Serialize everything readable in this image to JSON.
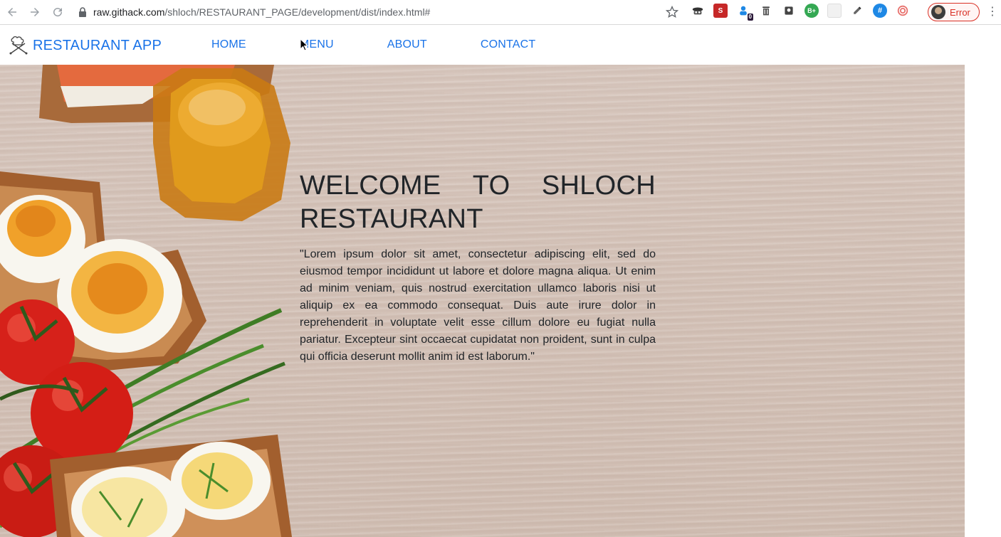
{
  "browser": {
    "url_host": "raw.githack.com",
    "url_path": "/shloch/RESTAURANT_PAGE/development/dist/index.html#",
    "profile_status": "Error",
    "extension_badge": "0",
    "extension_b_plus": "B+",
    "extension_hash": "#",
    "extension_s": "S"
  },
  "navbar": {
    "brand": "RESTAURANT APP",
    "links": [
      "HOME",
      "MENU",
      "ABOUT",
      "CONTACT"
    ]
  },
  "hero": {
    "title_words": [
      "WELCOME",
      "TO",
      "SHLOCH"
    ],
    "title_line2": "RESTAURANT",
    "paragraph": "\"Lorem ipsum dolor sit amet, consectetur adipiscing elit, sed do eiusmod tempor incididunt ut labore et dolore magna aliqua. Ut enim ad minim veniam, quis nostrud exercitation ullamco laboris nisi ut aliquip ex ea commodo consequat. Duis aute irure dolor in reprehenderit in voluptate velit esse cillum dolore eu fugiat nulla pariatur. Excepteur sint occaecat cupidatat non proident, sunt in culpa qui officia deserunt mollit anim id est laborum.\""
  },
  "colors": {
    "link": "#1a73e8",
    "text": "#212529",
    "error": "#d93025"
  }
}
